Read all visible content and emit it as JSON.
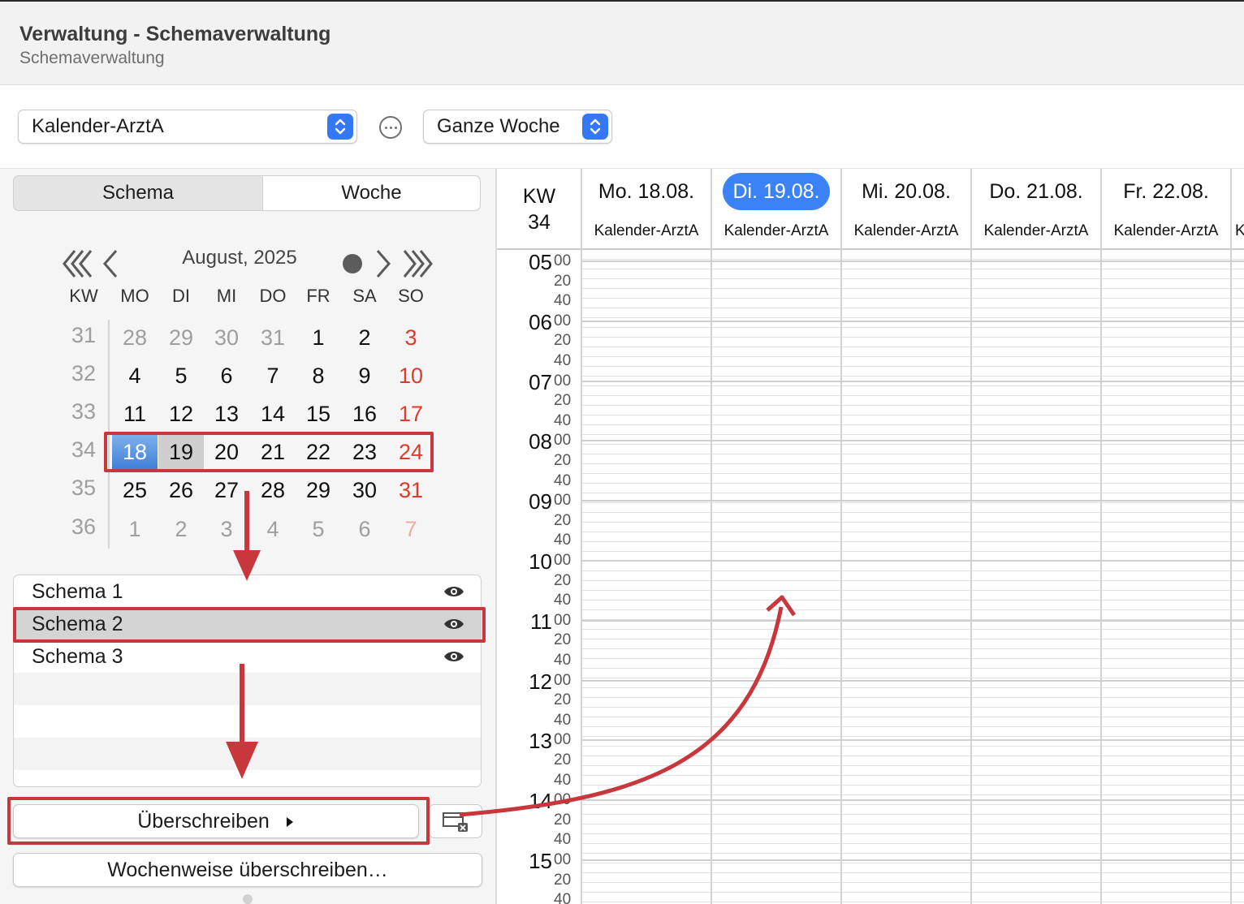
{
  "header": {
    "title": "Verwaltung - Schemaverwaltung",
    "subtitle": "Schemaverwaltung"
  },
  "toolbar": {
    "calendar_select": "Kalender-ArztA",
    "more_icon": "ellipsis-circle-icon",
    "range_select": "Ganze Woche"
  },
  "segments": {
    "left": "Schema",
    "right": "Woche"
  },
  "calendar": {
    "month_label": "August, 2025",
    "headers": [
      "KW",
      "MO",
      "DI",
      "MI",
      "DO",
      "FR",
      "SA",
      "SO"
    ],
    "weeks": [
      {
        "kw": "31",
        "days": [
          "28",
          "29",
          "30",
          "31",
          "1",
          "2",
          "3"
        ]
      },
      {
        "kw": "32",
        "days": [
          "4",
          "5",
          "6",
          "7",
          "8",
          "9",
          "10"
        ]
      },
      {
        "kw": "33",
        "days": [
          "11",
          "12",
          "13",
          "14",
          "15",
          "16",
          "17"
        ]
      },
      {
        "kw": "34",
        "days": [
          "18",
          "19",
          "20",
          "21",
          "22",
          "23",
          "24"
        ]
      },
      {
        "kw": "35",
        "days": [
          "25",
          "26",
          "27",
          "28",
          "29",
          "30",
          "31"
        ]
      },
      {
        "kw": "36",
        "days": [
          "1",
          "2",
          "3",
          "4",
          "5",
          "6",
          "7"
        ]
      }
    ]
  },
  "schemas": [
    {
      "name": "Schema 1",
      "icon": "eye-icon"
    },
    {
      "name": "Schema 2",
      "icon": "eye-icon"
    },
    {
      "name": "Schema 3",
      "icon": "eye-icon"
    }
  ],
  "buttons": {
    "overwrite": "Überschreiben",
    "overwrite_weekly": "Wochenweise überschreiben…",
    "clear_icon": "window-clear-icon"
  },
  "week_view": {
    "kw_label": "KW",
    "kw_number": "34",
    "days": [
      {
        "label": "Mo. 18.08.",
        "calendar": "Kalender-ArztA"
      },
      {
        "label": "Di. 19.08.",
        "calendar": "Kalender-ArztA"
      },
      {
        "label": "Mi. 20.08.",
        "calendar": "Kalender-ArztA"
      },
      {
        "label": "Do. 21.08.",
        "calendar": "Kalender-ArztA"
      },
      {
        "label": "Fr. 22.08.",
        "calendar": "Kalender-ArztA"
      },
      {
        "label": "",
        "calendar": "K"
      }
    ],
    "hours": [
      "05",
      "06",
      "07",
      "08",
      "09",
      "10",
      "11",
      "12",
      "13",
      "14",
      "15"
    ],
    "minutes": [
      "00",
      "20",
      "40"
    ]
  },
  "colors": {
    "accent": "#3b82f6",
    "annotation_red": "#c8373c",
    "sunday_red": "#e03a2a"
  }
}
